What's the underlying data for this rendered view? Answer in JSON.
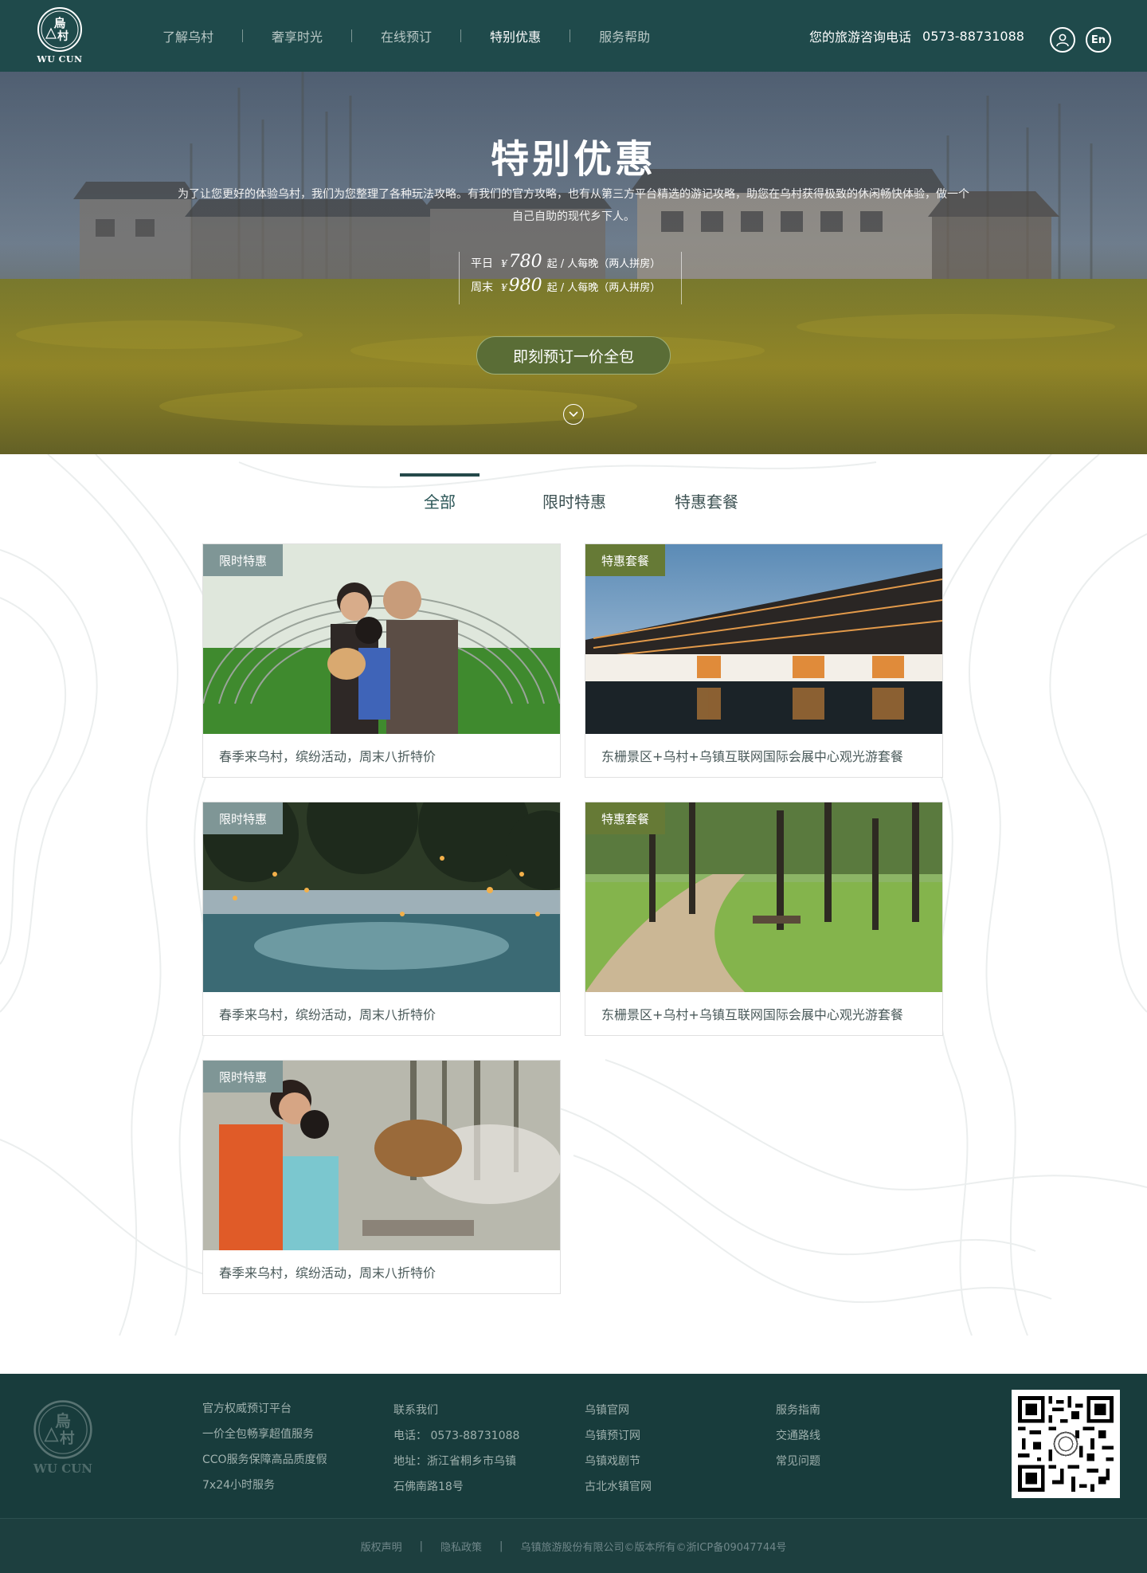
{
  "header": {
    "logo_text": "WU CUN",
    "nav": [
      "了解乌村",
      "奢享时光",
      "在线预订",
      "特别优惠",
      "服务帮助"
    ],
    "active_nav": 3,
    "hotline_label": "您的旅游咨询电话",
    "hotline_number": "0573-88731088",
    "lang_label": "En"
  },
  "hero": {
    "title": "特别优惠",
    "description": "为了让您更好的体验乌村，我们为您整理了各种玩法攻略。有我们的官方攻略，也有从第三方平台精选的游记攻略，助您在乌村获得极致的休闲畅快体验，做一个自己自助的现代乡下人。",
    "prices": [
      {
        "label": "平日",
        "currency": "¥",
        "value": "780",
        "unit": "起 / 人每晚（两人拼房）"
      },
      {
        "label": "周末",
        "currency": "¥",
        "value": "980",
        "unit": "起 / 人每晚（两人拼房）"
      }
    ],
    "book_button": "即刻预订一价全包"
  },
  "tabs": {
    "items": [
      "全部",
      "限时特惠",
      "特惠套餐"
    ],
    "active": 0
  },
  "cards": [
    {
      "badge": "限时特惠",
      "badge_type": "limit",
      "caption": "春季来乌村，缤纷活动，周末八折特价",
      "image_icon": "family-photo"
    },
    {
      "badge": "特惠套餐",
      "badge_type": "package",
      "caption": "东栅景区+乌村+乌镇互联网国际会展中心观光游套餐",
      "image_icon": "building-photo"
    },
    {
      "badge": "限时特惠",
      "badge_type": "limit",
      "caption": "春季来乌村，缤纷活动，周末八折特价",
      "image_icon": "stars-garden-photo"
    },
    {
      "badge": "特惠套餐",
      "badge_type": "package",
      "caption": "东栅景区+乌村+乌镇互联网国际会展中心观光游套餐",
      "image_icon": "forest-path-photo"
    },
    {
      "badge": "限时特惠",
      "badge_type": "limit",
      "caption": "春季来乌村，缤纷活动，周末八折特价",
      "image_icon": "cooking-photo"
    }
  ],
  "footer": {
    "logo_text": "WU CUN",
    "col1": [
      "官方权威预订平台",
      "一价全包畅享超值服务",
      "CCO服务保障高品质度假",
      "7x24小时服务"
    ],
    "col2": [
      "联系我们",
      "电话：  0573-88731088",
      "地址：浙江省桐乡市乌镇",
      "石佛南路18号"
    ],
    "col3": [
      "乌镇官网",
      "乌镇预订网",
      "乌镇戏剧节",
      "古北水镇官网"
    ],
    "col4": [
      "服务指南",
      "交通路线",
      "常见问题"
    ],
    "bottom": {
      "copyright_link": "版权声明",
      "privacy_link": "隐私政策",
      "company": "乌镇旅游股份有限公司©版本所有©浙ICP备09047744号"
    }
  },
  "colors": {
    "header_bg": "#1f4a4b",
    "footer_bg": "#183c3c",
    "badge_limit": "#7f9696",
    "badge_package": "#667a36",
    "button_green": "#5a6d36"
  }
}
